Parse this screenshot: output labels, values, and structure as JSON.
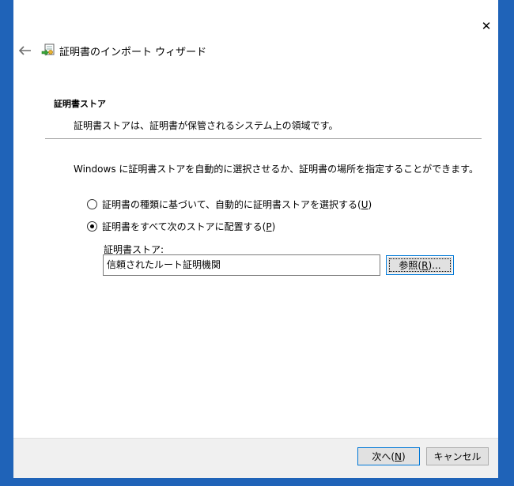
{
  "window": {
    "title": "証明書のインポート ウィザード",
    "close_glyph": "✕",
    "back_glyph": "←"
  },
  "page": {
    "heading": "証明書ストア",
    "description": "証明書ストアは、証明書が保管されるシステム上の領域です。",
    "intro": "Windows に証明書ストアを自動的に選択させるか、証明書の場所を指定することができます。"
  },
  "options": [
    {
      "label": "証明書の種類に基づいて、自動的に証明書ストアを選択する(",
      "accel": "U",
      "tail": ")",
      "checked": false
    },
    {
      "label": "証明書をすべて次のストアに配置する(",
      "accel": "P",
      "tail": ")",
      "checked": true
    }
  ],
  "store": {
    "label": "証明書ストア:",
    "value": "信頼されたルート証明機関",
    "browse_prefix": "参照(",
    "browse_accel": "R",
    "browse_suffix": ")..."
  },
  "footer": {
    "next_prefix": "次へ(",
    "next_accel": "N",
    "next_suffix": ")",
    "cancel_label": "キャンセル"
  },
  "colors": {
    "frame": "#1f63b8",
    "focus": "#0078d7",
    "footer_bg": "#f0f0f0"
  },
  "icons": {
    "back": "back-arrow-icon",
    "wizard": "certificate-icon",
    "close": "close-icon"
  }
}
